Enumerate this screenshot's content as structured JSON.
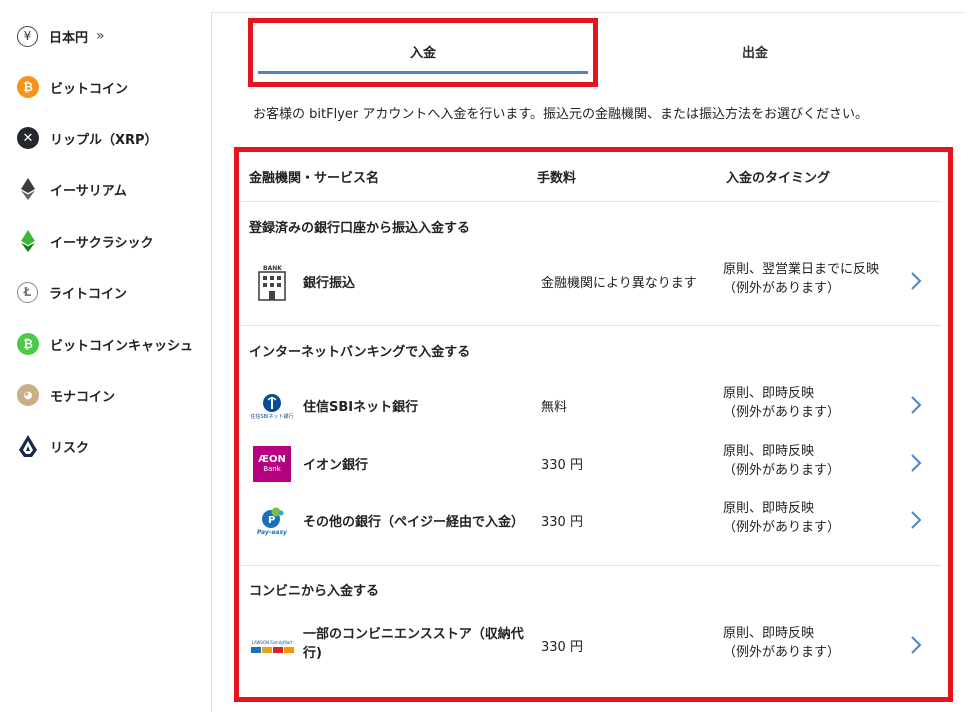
{
  "sidebar": {
    "items": [
      {
        "label": "日本円",
        "more": "»",
        "icon": "yen-icon"
      },
      {
        "label": "ビットコイン",
        "icon": "bitcoin-icon"
      },
      {
        "label": "リップル（XRP）",
        "icon": "xrp-icon"
      },
      {
        "label": "イーサリアム",
        "icon": "ethereum-icon"
      },
      {
        "label": "イーサクラシック",
        "icon": "ethereum-classic-icon"
      },
      {
        "label": "ライトコイン",
        "icon": "litecoin-icon"
      },
      {
        "label": "ビットコインキャッシュ",
        "icon": "bitcoin-cash-icon"
      },
      {
        "label": "モナコイン",
        "icon": "monacoin-icon"
      },
      {
        "label": "リスク",
        "icon": "lisk-icon"
      }
    ]
  },
  "tabs": {
    "deposit": "入金",
    "withdraw": "出金"
  },
  "intro": "お客様の bitFlyer アカウントへ入金を行います。振込元の金融機関、または振込方法をお選びください。",
  "table": {
    "headers": {
      "name": "金融機関・サービス名",
      "fee": "手数料",
      "timing": "入金のタイミング"
    },
    "sections": [
      {
        "title": "登録済みの銀行口座から振込入金する",
        "rows": [
          {
            "name": "銀行振込",
            "fee": "金融機関により異なります",
            "timing1": "原則、翌営業日までに反映",
            "timing2": "（例外があります）",
            "logo_text": "BANK"
          }
        ]
      },
      {
        "title": "インターネットバンキングで入金する",
        "rows": [
          {
            "name": "住信SBIネット銀行",
            "fee": "無料",
            "timing1": "原則、即時反映",
            "timing2": "（例外があります）",
            "logo_text": "住信SBIネット銀行"
          },
          {
            "name": "イオン銀行",
            "fee": "330 円",
            "timing1": "原則、即時反映",
            "timing2": "（例外があります）",
            "logo_text1": "ÆON",
            "logo_text2": "Bank"
          },
          {
            "name": "その他の銀行（ペイジー経由で入金）",
            "fee": "330 円",
            "timing1": "原則、即時反映",
            "timing2": "（例外があります）",
            "logo_text": "Pay-easy"
          }
        ]
      },
      {
        "title": "コンビニから入金する",
        "rows": [
          {
            "name1": "一部のコンビニエンスストア（収納代",
            "name2": "行)",
            "fee": "330 円",
            "timing1": "原則、即時反映",
            "timing2": "（例外があります）",
            "logo_text": "LAWSON FamilyMart"
          }
        ]
      }
    ]
  },
  "colors": {
    "accent": "#4a86c5",
    "highlight": "#e2141e",
    "aeon": "#b5007f"
  }
}
